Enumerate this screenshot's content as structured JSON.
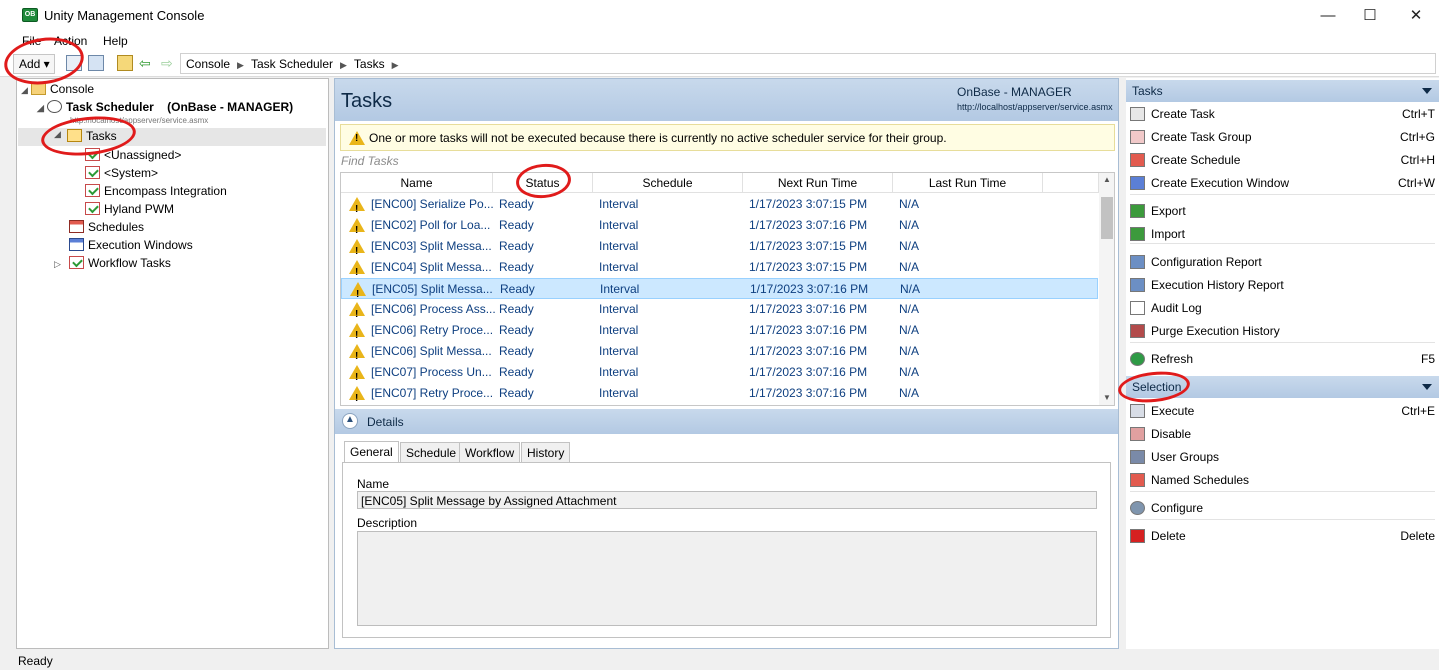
{
  "window": {
    "title": "Unity Management Console",
    "minimize": "—",
    "maximize": "☐",
    "close": "✕",
    "app_icon_text": "OB"
  },
  "menu": [
    "File",
    "Action",
    "Help"
  ],
  "toolbar": {
    "add_label": "Add ▾"
  },
  "breadcrumb": [
    "Console",
    "Task Scheduler",
    "Tasks"
  ],
  "tree": {
    "root": "Console",
    "scheduler": "Task Scheduler    (OnBase - MANAGER)",
    "scheduler_url": "http://localhost/appserver/service.asmx",
    "tasks": "Tasks",
    "groups": [
      "<Unassigned>",
      "<System>",
      "Encompass Integration",
      "Hyland PWM"
    ],
    "schedules": "Schedules",
    "execution_windows": "Execution Windows",
    "workflow_tasks": "Workflow Tasks"
  },
  "center": {
    "title": "Tasks",
    "server": "OnBase - MANAGER",
    "url": "http://localhost/appserver/service.asmx",
    "warning": "One or more tasks will not be executed because there is currently no active scheduler service for their group.",
    "find_placeholder": "Find Tasks",
    "columns": [
      "Name",
      "Status",
      "Schedule",
      "Next Run Time",
      "Last Run Time"
    ],
    "rows": [
      {
        "name": "[ENC00] Serialize Po...",
        "status": "Ready",
        "schedule": "Interval",
        "next": "1/17/2023 3:07:15 PM",
        "last": "N/A"
      },
      {
        "name": "[ENC02] Poll for Loa...",
        "status": "Ready",
        "schedule": "Interval",
        "next": "1/17/2023 3:07:16 PM",
        "last": "N/A"
      },
      {
        "name": "[ENC03] Split Messa...",
        "status": "Ready",
        "schedule": "Interval",
        "next": "1/17/2023 3:07:15 PM",
        "last": "N/A"
      },
      {
        "name": "[ENC04] Split Messa...",
        "status": "Ready",
        "schedule": "Interval",
        "next": "1/17/2023 3:07:15 PM",
        "last": "N/A"
      },
      {
        "name": "[ENC05] Split Messa...",
        "status": "Ready",
        "schedule": "Interval",
        "next": "1/17/2023 3:07:16 PM",
        "last": "N/A",
        "selected": true
      },
      {
        "name": "[ENC06] Process Ass...",
        "status": "Ready",
        "schedule": "Interval",
        "next": "1/17/2023 3:07:16 PM",
        "last": "N/A"
      },
      {
        "name": "[ENC06] Retry Proce...",
        "status": "Ready",
        "schedule": "Interval",
        "next": "1/17/2023 3:07:16 PM",
        "last": "N/A"
      },
      {
        "name": "[ENC06] Split Messa...",
        "status": "Ready",
        "schedule": "Interval",
        "next": "1/17/2023 3:07:16 PM",
        "last": "N/A"
      },
      {
        "name": "[ENC07] Process Un...",
        "status": "Ready",
        "schedule": "Interval",
        "next": "1/17/2023 3:07:16 PM",
        "last": "N/A"
      },
      {
        "name": "[ENC07] Retry Proce...",
        "status": "Ready",
        "schedule": "Interval",
        "next": "1/17/2023 3:07:16 PM",
        "last": "N/A"
      }
    ],
    "details_label": "Details",
    "tabs": [
      "General",
      "Schedule",
      "Workflow",
      "History"
    ],
    "name_label": "Name",
    "name_value": "[ENC05] Split Message by Assigned Attachment",
    "description_label": "Description"
  },
  "actions": {
    "tasks_header": "Tasks",
    "tasks": [
      {
        "label": "Create Task",
        "shortcut": "Ctrl+T",
        "icon": "create-task-icon"
      },
      {
        "label": "Create Task Group",
        "shortcut": "Ctrl+G",
        "icon": "create-task-group-icon"
      },
      {
        "label": "Create Schedule",
        "shortcut": "Ctrl+H",
        "icon": "create-schedule-icon"
      },
      {
        "label": "Create Execution Window",
        "shortcut": "Ctrl+W",
        "icon": "create-execution-window-icon"
      },
      {
        "label": "Export",
        "shortcut": "",
        "icon": "export-icon"
      },
      {
        "label": "Import",
        "shortcut": "",
        "icon": "import-icon"
      },
      {
        "label": "Configuration Report",
        "shortcut": "",
        "icon": "report-icon"
      },
      {
        "label": "Execution History Report",
        "shortcut": "",
        "icon": "report-icon"
      },
      {
        "label": "Audit Log",
        "shortcut": "",
        "icon": "log-icon"
      },
      {
        "label": "Purge Execution History",
        "shortcut": "",
        "icon": "purge-icon"
      },
      {
        "label": "Refresh",
        "shortcut": "F5",
        "icon": "refresh-icon"
      }
    ],
    "selection_header": "Selection",
    "selection": [
      {
        "label": "Execute",
        "shortcut": "Ctrl+E",
        "icon": "execute-icon"
      },
      {
        "label": "Disable",
        "shortcut": "",
        "icon": "disable-icon"
      },
      {
        "label": "User Groups",
        "shortcut": "",
        "icon": "user-groups-icon"
      },
      {
        "label": "Named Schedules",
        "shortcut": "",
        "icon": "named-schedules-icon"
      },
      {
        "label": "Configure",
        "shortcut": "",
        "icon": "configure-icon"
      },
      {
        "label": "Delete",
        "shortcut": "Delete",
        "icon": "delete-icon"
      }
    ]
  },
  "status": "Ready",
  "colors": {
    "accent_header": "#b3c9e3",
    "selected_row": "#cce8ff",
    "annotation": "#e01b1b",
    "link_text": "#0e3f80"
  }
}
